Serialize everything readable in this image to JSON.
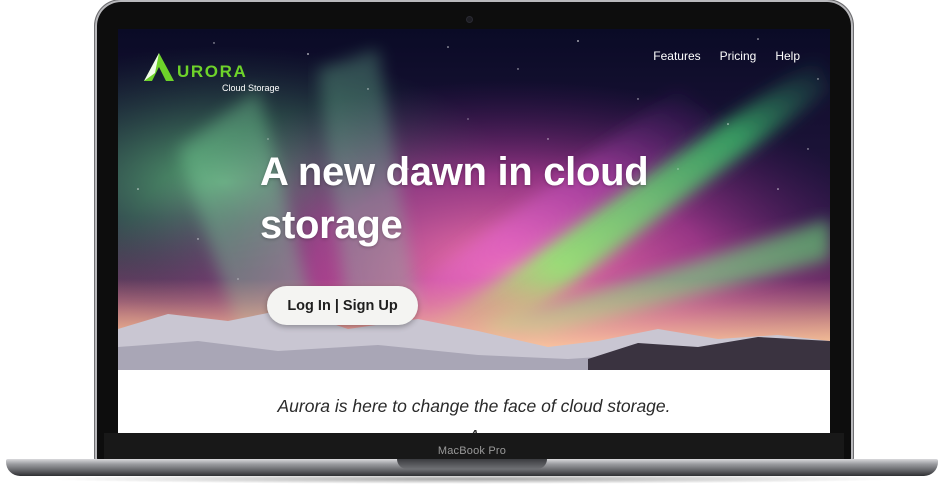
{
  "device": {
    "brand_label": "MacBook Pro"
  },
  "site": {
    "logo": {
      "word": "URORA",
      "subtitle": "Cloud Storage",
      "mark_color": "#6ed32a"
    },
    "nav": {
      "items": [
        {
          "label": "Features"
        },
        {
          "label": "Pricing"
        },
        {
          "label": "Help"
        }
      ]
    },
    "hero": {
      "headline": "A new dawn in cloud storage",
      "cta_label": "Log In | Sign Up",
      "colors": {
        "aurora_green": "#4fe06a",
        "aurora_magenta": "#d04ac0",
        "sky": "#0b0d2b",
        "horizon_orange": "#f5a07a"
      }
    },
    "intro": {
      "tagline": "Aurora is here to change the face of cloud storage.",
      "tagline_partial": "A"
    }
  }
}
